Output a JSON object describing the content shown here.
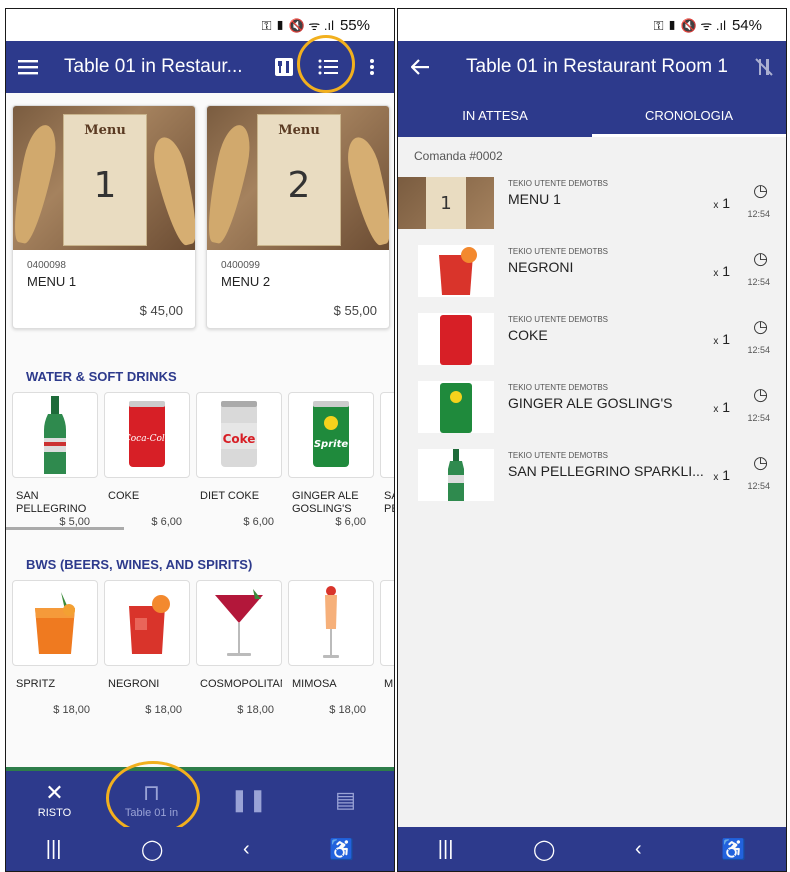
{
  "left": {
    "status": {
      "signal_icons": "⚿ ▮ 🔇 ᯤ .ıl",
      "battery": "55%"
    },
    "appbar": {
      "title": "Table 01 in Restaur...",
      "menu_icon": "hamburger-icon",
      "cutlery_icon": "cutlery-icon",
      "list_icon": "list-icon",
      "more_icon": "more-vert-icon"
    },
    "menus": [
      {
        "code": "0400098",
        "name": "MENU 1",
        "price": "$ 45,00",
        "label": "Menu",
        "number": "1"
      },
      {
        "code": "0400099",
        "name": "MENU 2",
        "price": "$ 55,00",
        "label": "Menu",
        "number": "2"
      }
    ],
    "sections": [
      {
        "title": "WATER & SOFT DRINKS",
        "products": [
          {
            "name": "SAN PELLEGRINO ...",
            "price": "$ 5,00",
            "image": "green-bottle",
            "img_text": ""
          },
          {
            "name": "COKE",
            "price": "$ 6,00",
            "image": "red-can",
            "img_text": "Coca-Cola"
          },
          {
            "name": "DIET COKE",
            "price": "$ 6,00",
            "image": "silver-can",
            "img_text": "Coke"
          },
          {
            "name": "GINGER ALE GOSLING'S",
            "price": "$ 6,00",
            "image": "green-can",
            "img_text": "Sprite"
          },
          {
            "name": "SA PE",
            "price": "",
            "image": "partial",
            "img_text": ""
          }
        ]
      },
      {
        "title": "BWS (BEERS, WINES, AND SPIRITS)",
        "products": [
          {
            "name": "SPRITZ",
            "price": "$ 18,00",
            "image": "orange-glass",
            "img_text": ""
          },
          {
            "name": "NEGRONI",
            "price": "$ 18,00",
            "image": "red-glass",
            "img_text": ""
          },
          {
            "name": "COSMOPOLITAN",
            "price": "$ 18,00",
            "image": "martini",
            "img_text": ""
          },
          {
            "name": "MIMOSA",
            "price": "$ 18,00",
            "image": "flute",
            "img_text": ""
          },
          {
            "name": "M",
            "price": "",
            "image": "partial",
            "img_text": ""
          }
        ]
      }
    ],
    "bottomnav": [
      {
        "label": "RISTO",
        "icon": "cutlery-icon",
        "glyph": "✕"
      },
      {
        "label": "Table 01 in",
        "icon": "table-icon",
        "glyph": "⊓"
      },
      {
        "label": "",
        "icon": "pause-icon",
        "glyph": "❚❚"
      },
      {
        "label": "",
        "icon": "receipt-icon",
        "glyph": "▤"
      }
    ]
  },
  "right": {
    "status": {
      "signal_icons": "⚿ ▮ 🔇 ᯤ .ıl",
      "battery": "54%"
    },
    "appbar": {
      "title": "Table 01 in Restaurant Room 1",
      "back_icon": "back-arrow-icon",
      "nocutlery_icon": "no-cutlery-icon"
    },
    "tabs": [
      {
        "label": "IN ATTESA"
      },
      {
        "label": "CRONOLOGIA"
      }
    ],
    "order_title": "Comanda #0002",
    "items": [
      {
        "user": "TEKIO UTENTE DEMOTBS",
        "name": "MENU 1",
        "qty_prefix": "x",
        "qty": "1",
        "time": "12:54",
        "image": "menu"
      },
      {
        "user": "TEKIO UTENTE DEMOTBS",
        "name": "NEGRONI",
        "qty_prefix": "x",
        "qty": "1",
        "time": "12:54",
        "image": "red-glass"
      },
      {
        "user": "TEKIO UTENTE DEMOTBS",
        "name": "COKE",
        "qty_prefix": "x",
        "qty": "1",
        "time": "12:54",
        "image": "red-can"
      },
      {
        "user": "TEKIO UTENTE DEMOTBS",
        "name": "GINGER ALE GOSLING'S",
        "qty_prefix": "x",
        "qty": "1",
        "time": "12:54",
        "image": "green-can"
      },
      {
        "user": "TEKIO UTENTE DEMOTBS",
        "name": "SAN PELLEGRINO SPARKLI...",
        "qty_prefix": "x",
        "qty": "1",
        "time": "12:54",
        "image": "green-bottle"
      }
    ]
  },
  "sysnav": {
    "recent": "|||",
    "home": "◯",
    "back": "‹",
    "accessibility": "♿"
  },
  "colors": {
    "primary": "#2d3a8c",
    "accent_ring": "#f2b01e",
    "nav_green": "#2e7d4a"
  }
}
